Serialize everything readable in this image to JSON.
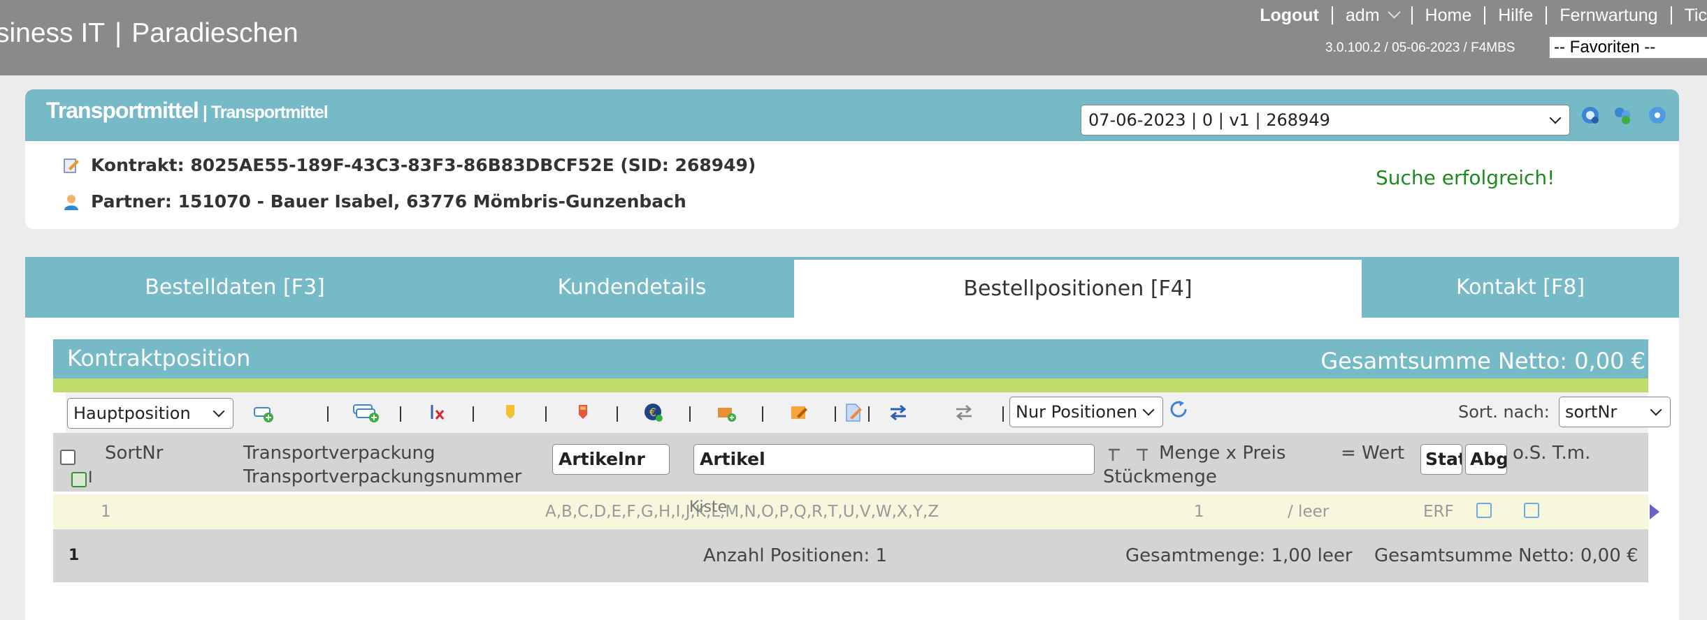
{
  "header": {
    "brand_left": "siness IT",
    "brand_sep": "|",
    "brand_right": "Paradieschen",
    "nav": {
      "logout": "Logout",
      "user": "adm",
      "home": "Home",
      "help": "Hilfe",
      "remote": "Fernwartung",
      "tickets": "Tic"
    },
    "version": "3.0.100.2 / 05-06-2023 / F4MBS",
    "favorites": "-- Favoriten --"
  },
  "contract_card": {
    "title_main": "Transportmittel",
    "title_sep": " | ",
    "title_sub": "Transportmittel",
    "version_select": "07-06-2023 | 0 | v1 | 268949",
    "contract_line": "Kontrakt: 8025AE55-189F-43C3-83F3-86B83DBCF52E (SID: 268949)",
    "partner_line": "Partner: 151070 - Bauer Isabel, 63776 Mömbris-Gunzenbach",
    "status_message": "Suche erfolgreich!"
  },
  "tabs": [
    {
      "label": "Bestelldaten [F3]"
    },
    {
      "label": "Kundendetails"
    },
    {
      "label": "Bestellpositionen [F4]"
    },
    {
      "label": "Kontakt [F8]"
    }
  ],
  "panel": {
    "title": "Kontraktposition",
    "total": "Gesamtsumme Netto: 0,00 €"
  },
  "toolbar": {
    "position_select": "Hauptposition",
    "filter_select": "Nur Positionen",
    "sort_label": "Sort. nach:",
    "sort_select": "sortNr"
  },
  "table": {
    "headers": {
      "sortnr": "SortNr",
      "packaging": "Transportverpackung",
      "packaging_no": "Transportverpackungsnummer",
      "article_no_input": "Artikelnr",
      "article_input": "Artikel",
      "qty_price": "Menge x Preis",
      "value": "= Wert",
      "piece_qty": "Stückmenge",
      "status_input": "Stat",
      "abg_input": "Abg",
      "os_tm": "o.S. T.m.",
      "row_flag": "I"
    },
    "rows": [
      {
        "sortnr": "1",
        "alphabet": "A,B,C,D,E,F,G,H,I,J,K,L,M,N,O,P,Q,R,T,U,V,W,X,Y,Z",
        "article": "Kiste",
        "qty": "1",
        "unit": "/ leer",
        "status": "ERF"
      }
    ],
    "footer": {
      "count": "1",
      "positions": "Anzahl Positionen: 1",
      "total_qty": "Gesamtmenge: 1,00 leer",
      "total_net": "Gesamtsumme Netto: 0,00 €"
    }
  },
  "colors": {
    "topbar": "#8a8a8a",
    "accent": "#76b9c7",
    "green_bar": "#bedc6a",
    "success": "#1c8a1c",
    "row_highlight": "#f7f7dd"
  }
}
